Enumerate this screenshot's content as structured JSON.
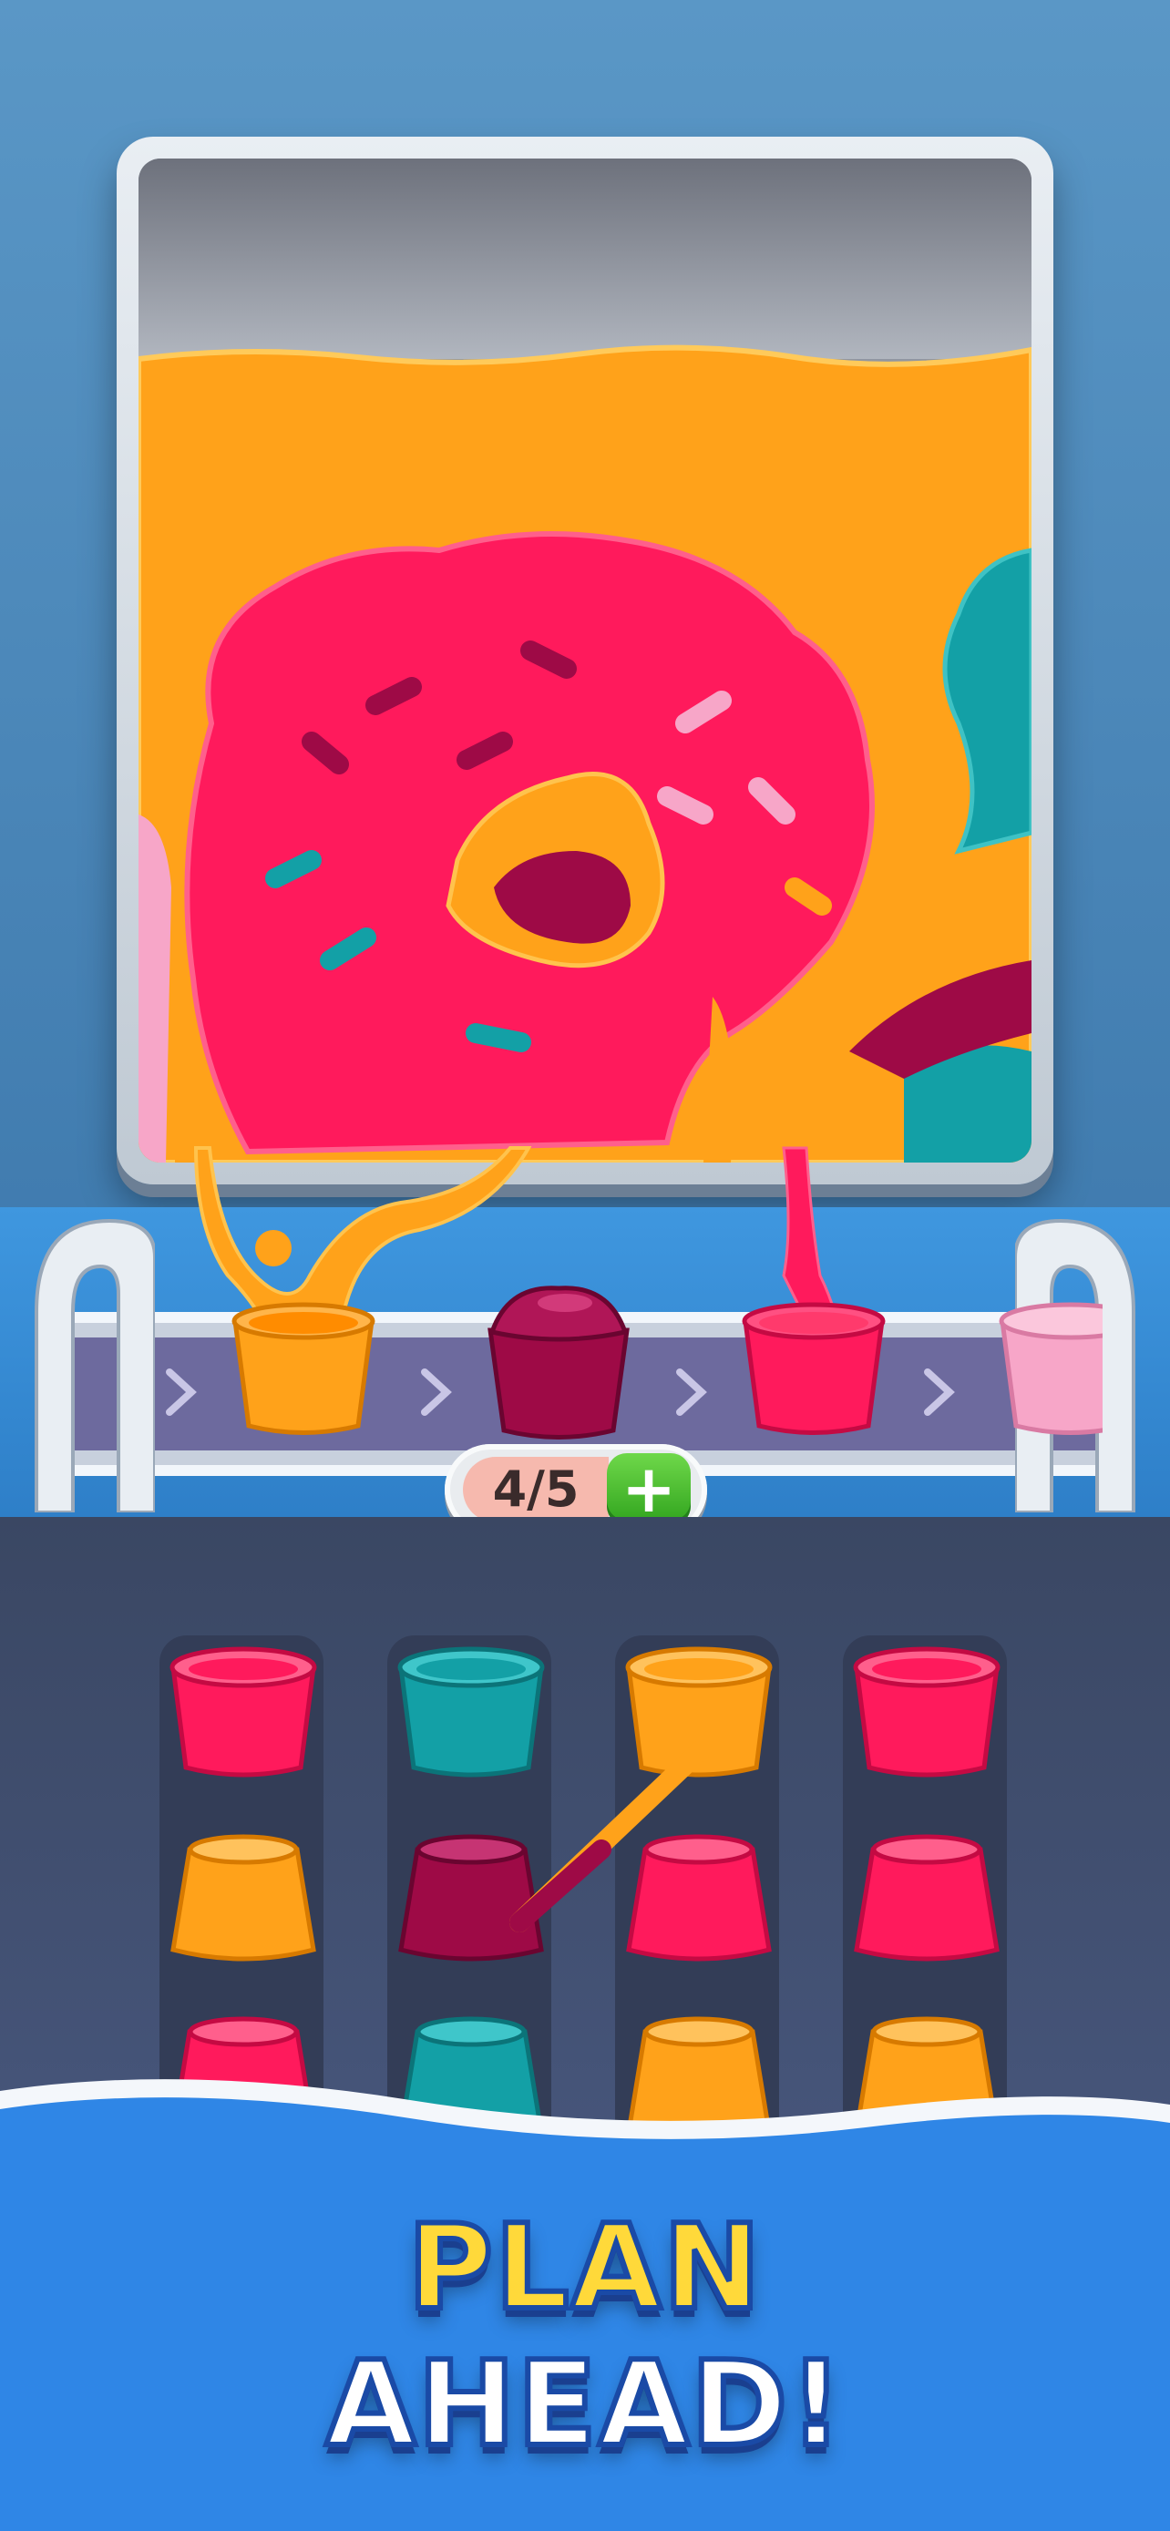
{
  "hud": {
    "progress_text": "4/5",
    "progress_current": 4,
    "progress_total": 5,
    "add_label": "+"
  },
  "banner": {
    "line1": "PLAN",
    "line2": "AHEAD!"
  },
  "colors": {
    "orange": "#ffa21a",
    "pink": "#ff1a5c",
    "maroon": "#9e0a46",
    "teal": "#13a0a6",
    "light_pink": "#f7a6c8",
    "board": "#3d4a69",
    "belt": "#6d6a9e",
    "banner": "#2f86e6"
  },
  "painting": {
    "subject": "frosted donut with sprinkles",
    "layers": [
      "orange",
      "pink",
      "maroon",
      "teal"
    ]
  },
  "conveyor_cups": [
    {
      "color": "orange",
      "state": "filling"
    },
    {
      "color": "maroon",
      "state": "full"
    },
    {
      "color": "pink",
      "state": "filling"
    },
    {
      "color": "light_pink",
      "state": "empty"
    }
  ],
  "cup_grid": [
    [
      "pink",
      "orange",
      "pink"
    ],
    [
      "teal",
      "maroon",
      "teal"
    ],
    [
      "orange",
      "pink",
      "orange"
    ],
    [
      "pink",
      "pink",
      "orange"
    ]
  ]
}
